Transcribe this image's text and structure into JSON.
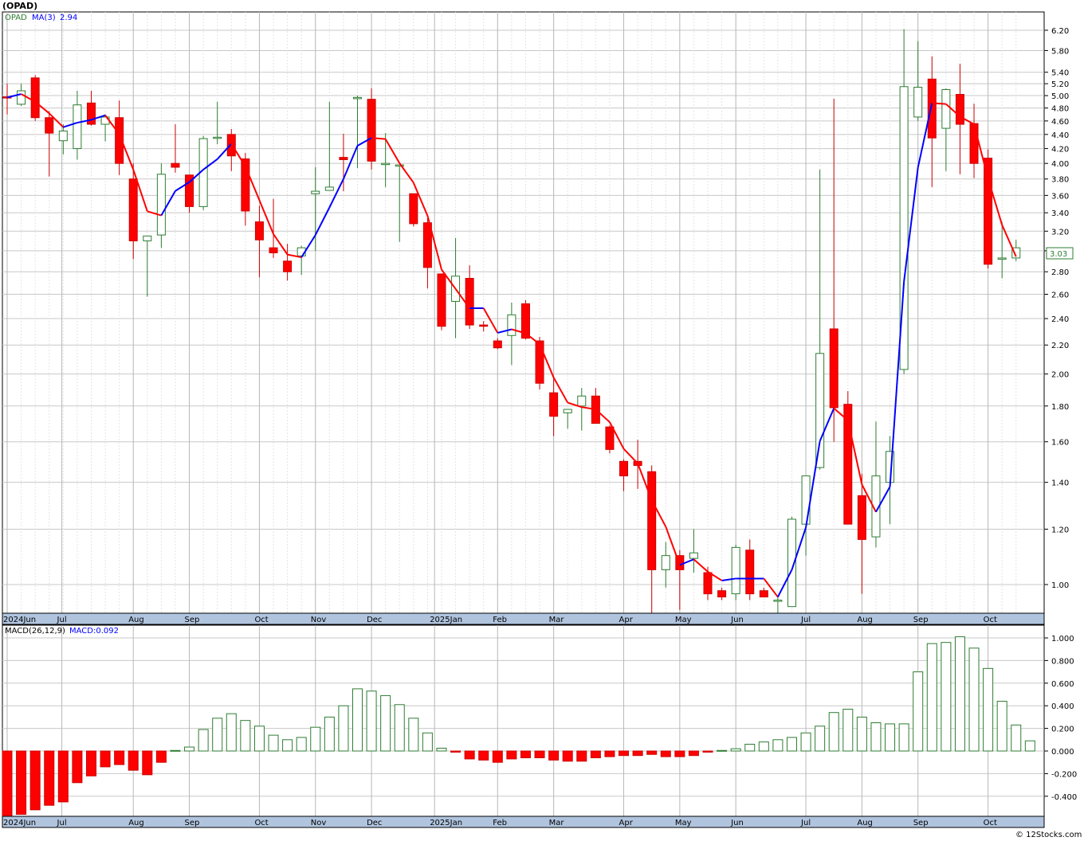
{
  "ticker_title": "(OPAD)",
  "price_legend": {
    "symbol": "OPAD",
    "ma_label": "MA(3)",
    "ma_value": "2.94"
  },
  "macd_legend": {
    "label": "MACD(26,12,9)",
    "value_label": "MACD:0.092"
  },
  "last_price": "3.03",
  "watermark": "© 12Stocks.com",
  "colors": {
    "up": "#2e7d32",
    "down": "#ff0000",
    "ma_up": "#0000ff",
    "ma_down": "#ff0000",
    "grid": "#c8c8c8",
    "axis_band": "#b0c4de"
  },
  "chart_data": [
    {
      "type": "candlestick",
      "title": "(OPAD)",
      "scale": "log",
      "ylim": [
        0.9,
        6.5
      ],
      "y_ticks": [
        "1.00",
        "1.20",
        "1.40",
        "1.60",
        "1.80",
        "2.00",
        "2.20",
        "2.40",
        "2.60",
        "2.80",
        "3.00",
        "3.20",
        "3.40",
        "3.60",
        "3.80",
        "4.00",
        "4.20",
        "4.40",
        "4.60",
        "4.80",
        "5.00",
        "5.20",
        "5.40",
        "5.80",
        "6.20"
      ],
      "x_labels": [
        "2024Jun",
        "Jul",
        "Aug",
        "Sep",
        "Oct",
        "Nov",
        "Dec",
        "2025Jan",
        "Feb",
        "Mar",
        "Apr",
        "May",
        "Jun",
        "Jul",
        "Aug",
        "Sep",
        "Oct"
      ],
      "grid": true,
      "series": [
        {
          "name": "OPAD",
          "ohlc": [
            [
              4.98,
              5.2,
              4.7,
              4.97
            ],
            [
              4.86,
              5.2,
              4.83,
              5.08
            ],
            [
              5.3,
              5.35,
              4.6,
              4.65
            ],
            [
              4.65,
              4.75,
              3.83,
              4.42
            ],
            [
              4.31,
              4.55,
              4.12,
              4.45
            ],
            [
              4.2,
              5.08,
              4.05,
              4.85
            ],
            [
              4.88,
              5.08,
              4.53,
              4.55
            ],
            [
              4.55,
              4.7,
              4.3,
              4.66
            ],
            [
              4.65,
              4.92,
              3.85,
              4.0
            ],
            [
              3.8,
              4.0,
              2.92,
              3.1
            ],
            [
              3.1,
              3.15,
              2.58,
              3.15
            ],
            [
              3.16,
              4.0,
              3.03,
              3.86
            ],
            [
              4.0,
              4.55,
              3.88,
              3.95
            ],
            [
              3.85,
              3.85,
              3.4,
              3.47
            ],
            [
              3.47,
              4.38,
              3.43,
              4.34
            ],
            [
              4.36,
              4.9,
              4.26,
              4.36
            ],
            [
              4.4,
              4.48,
              3.9,
              4.1
            ],
            [
              4.06,
              4.14,
              3.26,
              3.42
            ],
            [
              3.3,
              3.48,
              2.75,
              3.11
            ],
            [
              3.03,
              3.56,
              2.93,
              2.98
            ],
            [
              2.9,
              3.07,
              2.72,
              2.8
            ],
            [
              2.95,
              3.05,
              2.77,
              3.03
            ],
            [
              3.62,
              3.95,
              3.0,
              3.65
            ],
            [
              3.66,
              4.9,
              3.7,
              3.7
            ],
            [
              4.08,
              4.41,
              3.65,
              4.05
            ],
            [
              4.95,
              5.0,
              3.94,
              4.97
            ],
            [
              4.94,
              5.12,
              3.92,
              4.03
            ],
            [
              4.0,
              4.42,
              3.7,
              4.0
            ],
            [
              3.97,
              3.99,
              3.09,
              3.98
            ],
            [
              3.62,
              3.62,
              3.25,
              3.28
            ],
            [
              3.29,
              3.34,
              2.65,
              2.84
            ],
            [
              2.78,
              2.78,
              2.31,
              2.34
            ],
            [
              2.54,
              3.13,
              2.25,
              2.76
            ],
            [
              2.74,
              2.86,
              2.32,
              2.35
            ],
            [
              2.35,
              2.38,
              2.3,
              2.34
            ],
            [
              2.23,
              2.25,
              2.17,
              2.18
            ],
            [
              2.27,
              2.53,
              2.06,
              2.43
            ],
            [
              2.52,
              2.55,
              2.24,
              2.25
            ],
            [
              2.23,
              2.26,
              1.9,
              1.94
            ],
            [
              1.88,
              1.98,
              1.63,
              1.74
            ],
            [
              1.76,
              1.78,
              1.67,
              1.78
            ],
            [
              1.8,
              1.91,
              1.66,
              1.86
            ],
            [
              1.86,
              1.91,
              1.7,
              1.7
            ],
            [
              1.68,
              1.69,
              1.54,
              1.56
            ],
            [
              1.5,
              1.51,
              1.36,
              1.43
            ],
            [
              1.5,
              1.61,
              1.37,
              1.48
            ],
            [
              1.45,
              1.48,
              0.91,
              1.05
            ],
            [
              1.05,
              1.15,
              0.99,
              1.1
            ],
            [
              1.1,
              1.12,
              0.92,
              1.05
            ],
            [
              1.09,
              1.2,
              1.04,
              1.11
            ],
            [
              1.04,
              1.06,
              0.95,
              0.97
            ],
            [
              0.98,
              0.99,
              0.95,
              0.96
            ],
            [
              0.97,
              1.14,
              0.95,
              1.13
            ],
            [
              1.12,
              1.16,
              0.95,
              0.97
            ],
            [
              0.98,
              0.99,
              0.96,
              0.96
            ],
            [
              0.95,
              0.96,
              0.91,
              0.95
            ],
            [
              0.93,
              1.25,
              0.94,
              1.24
            ],
            [
              1.22,
              1.33,
              1.1,
              1.43
            ],
            [
              1.47,
              3.92,
              1.46,
              2.14
            ],
            [
              2.32,
              4.95,
              1.6,
              1.79
            ],
            [
              1.81,
              1.89,
              1.23,
              1.22
            ],
            [
              1.34,
              1.44,
              0.97,
              1.16
            ],
            [
              1.17,
              1.71,
              1.13,
              1.43
            ],
            [
              1.4,
              1.63,
              1.22,
              1.55
            ],
            [
              2.03,
              6.22,
              2.0,
              5.15
            ],
            [
              4.66,
              5.98,
              4.6,
              5.14
            ],
            [
              5.28,
              5.69,
              3.7,
              4.35
            ],
            [
              4.49,
              5.12,
              3.9,
              5.1
            ],
            [
              5.02,
              5.55,
              3.86,
              4.55
            ],
            [
              4.56,
              4.87,
              3.81,
              4.0
            ],
            [
              4.07,
              4.19,
              2.83,
              2.87
            ],
            [
              2.92,
              3.3,
              2.74,
              2.93
            ],
            [
              2.93,
              3.11,
              2.9,
              3.03
            ]
          ]
        },
        {
          "name": "MA(3)",
          "value_label": "2.94"
        }
      ]
    },
    {
      "type": "bar",
      "title": "MACD(26,12,9)",
      "ylim": [
        -0.6,
        1.1
      ],
      "y_ticks": [
        "-0.400",
        "-0.200",
        "0.000",
        "0.200",
        "0.400",
        "0.600",
        "0.800",
        "1.000"
      ],
      "x_labels": [
        "2024Jun",
        "Jul",
        "Aug",
        "Sep",
        "Oct",
        "Nov",
        "Dec",
        "2025Jan",
        "Feb",
        "Mar",
        "Apr",
        "May",
        "Jun",
        "Jul",
        "Aug",
        "Sep",
        "Oct"
      ],
      "series": [
        {
          "name": "MACD",
          "values": [
            -0.59,
            -0.56,
            -0.52,
            -0.48,
            -0.45,
            -0.28,
            -0.22,
            -0.14,
            -0.12,
            -0.17,
            -0.21,
            -0.1,
            0.005,
            0.035,
            0.19,
            0.29,
            0.33,
            0.27,
            0.22,
            0.14,
            0.1,
            0.12,
            0.21,
            0.3,
            0.4,
            0.55,
            0.53,
            0.49,
            0.41,
            0.29,
            0.16,
            0.025,
            -0.01,
            -0.07,
            -0.08,
            -0.1,
            -0.07,
            -0.06,
            -0.06,
            -0.08,
            -0.09,
            -0.09,
            -0.06,
            -0.05,
            -0.04,
            -0.04,
            -0.03,
            -0.05,
            -0.05,
            -0.04,
            -0.01,
            0.005,
            0.02,
            0.06,
            0.08,
            0.1,
            0.12,
            0.16,
            0.22,
            0.34,
            0.37,
            0.3,
            0.25,
            0.24,
            0.24,
            0.7,
            0.95,
            0.96,
            1.01,
            0.91,
            0.73,
            0.44,
            0.23,
            0.09
          ]
        }
      ]
    }
  ]
}
